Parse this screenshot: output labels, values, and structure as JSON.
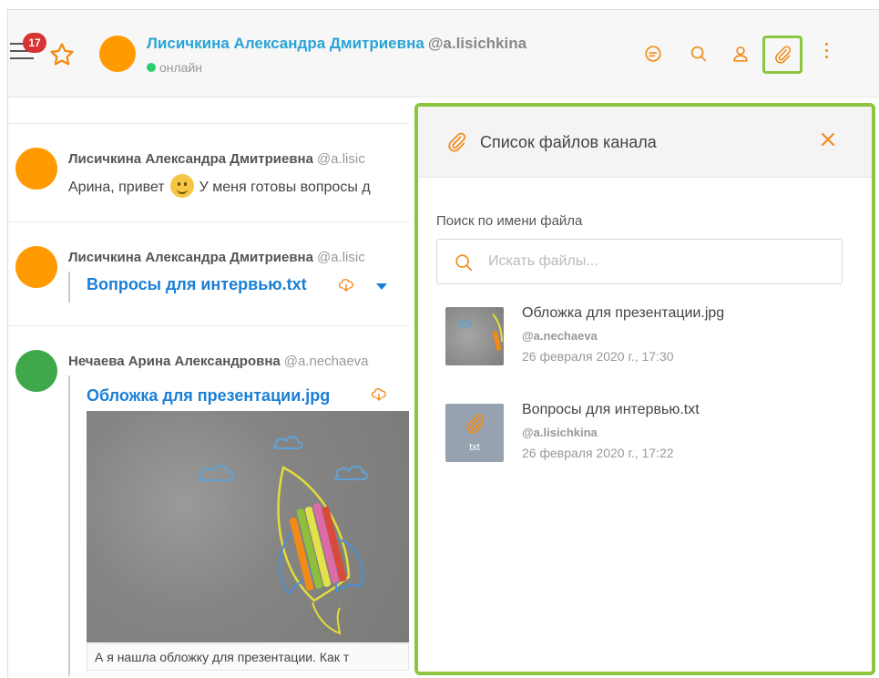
{
  "header": {
    "badge_count": "17",
    "name": "Лисичкина Александра Дмитриевна",
    "username": "@a.lisichkina",
    "status": "онлайн",
    "avatar_color": "#ff9a00",
    "accent_color": "#f28a16",
    "highlight_color": "#8cc63e",
    "buttons": [
      "discussion-icon",
      "search-icon",
      "user-icon",
      "paperclip-icon",
      "kebab-menu-icon"
    ]
  },
  "messages": [
    {
      "author": "Лисичкина Александра Дмитриевна",
      "username": "@a.lisic",
      "text_before": "Арина, привет",
      "text_after": "У меня готовы вопросы д",
      "avatar_color": "#ff9a00"
    },
    {
      "author": "Лисичкина Александра Дмитриевна",
      "username": "@a.lisic",
      "file": "Вопросы для интервью.txt",
      "avatar_color": "#ff9a00"
    },
    {
      "author": "Нечаева Арина Александровна",
      "username": "@a.nechaeva",
      "file": "Обложка для презентации.jpg",
      "caption": "А я нашла обложку для презентации. Как т",
      "avatar_color": "#3ea84a"
    }
  ],
  "panel": {
    "title": "Список файлов канала",
    "search_label": "Поиск по имени файла",
    "search_placeholder": "Искать файлы...",
    "files": [
      {
        "name": "Обложка для презентации.jpg",
        "user": "@a.nechaeva",
        "date": "26 февраля 2020 г., 17:30"
      },
      {
        "name": "Вопросы для интервью.txt",
        "user": "@a.lisichkina",
        "date": "26 февраля 2020 г., 17:22",
        "thumb_label": "txt"
      }
    ]
  }
}
